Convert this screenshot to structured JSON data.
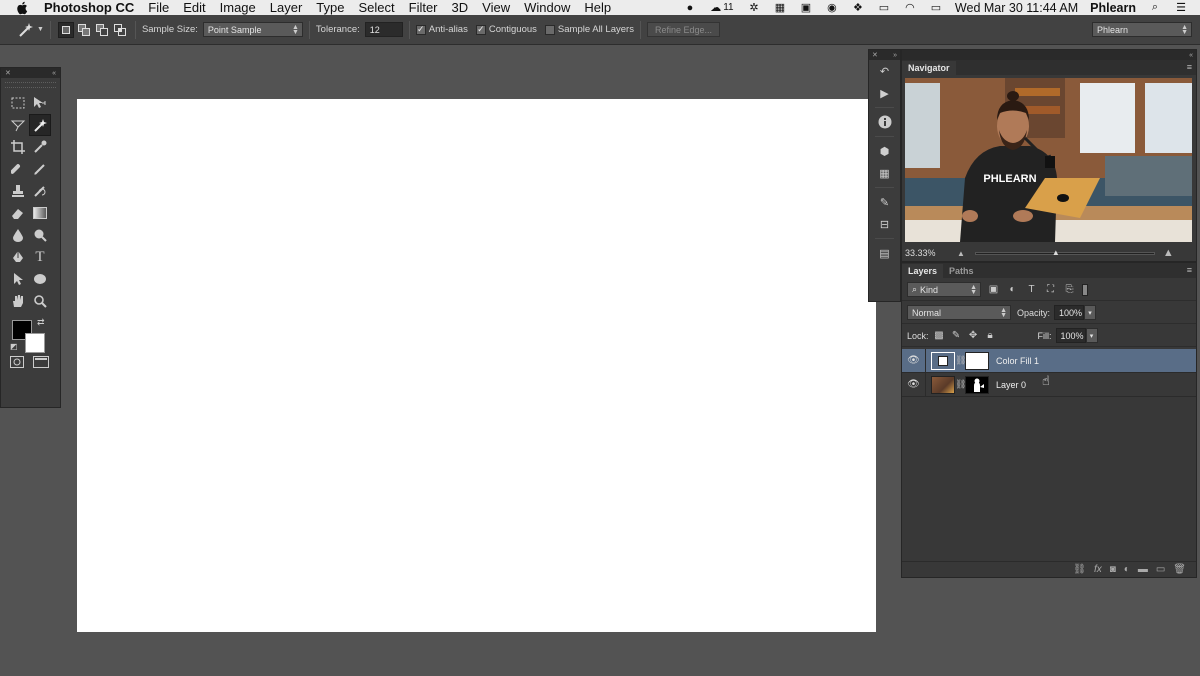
{
  "menubar": {
    "app_name": "Photoshop CC",
    "menus": [
      "File",
      "Edit",
      "Image",
      "Layer",
      "Type",
      "Select",
      "Filter",
      "3D",
      "View",
      "Window",
      "Help"
    ],
    "badge_count": "11",
    "datetime": "Wed Mar 30  11:44 AM",
    "user": "Phlearn"
  },
  "options": {
    "sample_size_label": "Sample Size:",
    "sample_size_value": "Point Sample",
    "tolerance_label": "Tolerance:",
    "tolerance_value": "12",
    "anti_alias_label": "Anti-alias",
    "contiguous_label": "Contiguous",
    "sample_all_label": "Sample All Layers",
    "refine_edge_label": "Refine Edge...",
    "workspace": "Phlearn",
    "anti_alias_checked": true,
    "contiguous_checked": true,
    "sample_all_checked": false
  },
  "navigator": {
    "tab": "Navigator",
    "zoom": "33.33%",
    "zoom_slider_fraction": 0.55,
    "photo_shirt_text": "PHLEARN"
  },
  "layers": {
    "tabs": [
      "Layers",
      "Paths"
    ],
    "filter_kind": "Kind",
    "blend_mode": "Normal",
    "opacity_label": "Opacity:",
    "opacity_value": "100%",
    "lock_label": "Lock:",
    "fill_label": "Fill:",
    "fill_value": "100%",
    "items": [
      {
        "name": "Color Fill 1",
        "selected": true
      },
      {
        "name": "Layer 0",
        "selected": false
      }
    ]
  },
  "colors": {
    "selected_layer": "#596d87",
    "foreground": "#000000",
    "background": "#ffffff"
  }
}
